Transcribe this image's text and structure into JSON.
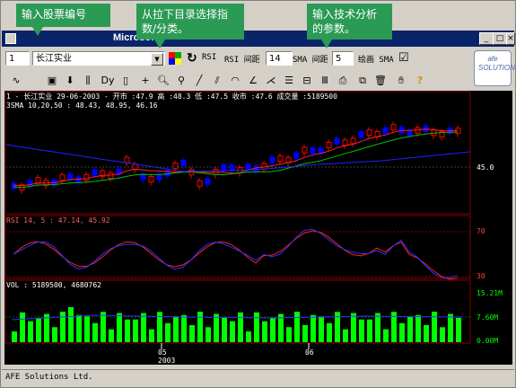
{
  "window": {
    "title": "Microsoft"
  },
  "toolbar1": {
    "stock_code": "1",
    "stock_name": "长江实业",
    "rsi_label": "RSI",
    "rsi_interval_label": "RSI 间距",
    "rsi_interval_value": "14",
    "sma_interval_label": "SMA 间距",
    "sma_interval_value": "5",
    "draw_sma_label": "绘画 SMA",
    "draw_sma_checked": "☑"
  },
  "callouts": [
    {
      "text": "输入股票编号"
    },
    {
      "text": "从拉下目录选择指数/分类。"
    },
    {
      "text": "输入技术分析的参数。"
    }
  ],
  "chart": {
    "price_header": "1 - 长江实业 29-06-2003 - 开市 :47.9 高 :48.3 低 :47.5 收市 :47.6 成交量 :5189500",
    "sma_header": "3SMA 10,20,50 : 48.43, 48.95, 46.16",
    "price_tick": "45.0",
    "rsi_header": "RSI 14, 5 : 47.14, 45.92",
    "rsi_ticks": [
      "70",
      "30"
    ],
    "vol_header": "VOL : 5189500, 4680762",
    "vol_ticks": [
      "15.21M",
      "7.60M",
      "0.00M"
    ],
    "x_months": [
      "05",
      "06"
    ],
    "x_year": "2003",
    "logo": "afe SOLUTIONS"
  },
  "status": "AFE Solutions Ltd.",
  "colors": {
    "bull": "#ff0000",
    "bear": "#0000ff",
    "volume": "#00ff00",
    "callout": "#2a9a55"
  }
}
